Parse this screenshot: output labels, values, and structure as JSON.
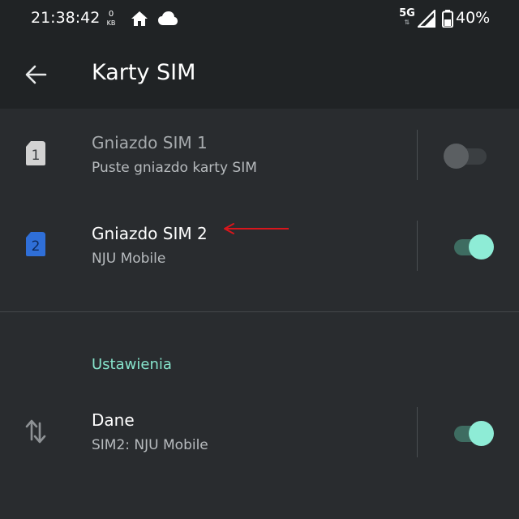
{
  "status_bar": {
    "time": "21:38:42",
    "net_speed_value": "0",
    "net_speed_unit": "KB",
    "network_type": "5G",
    "battery": "40%",
    "icons": [
      "home-icon",
      "cloud-icon",
      "signal-icon",
      "battery-icon"
    ]
  },
  "app_bar": {
    "title": "Karty SIM",
    "back_icon": "arrow-back-icon"
  },
  "sim_slots": [
    {
      "title": "Gniazdo SIM 1",
      "summary": "Puste gniazdo karty SIM",
      "badge": "1",
      "badge_color": "#d2d2d2",
      "enabled": false
    },
    {
      "title": "Gniazdo SIM 2",
      "summary": "NJU Mobile",
      "badge": "2",
      "badge_color": "#2f6fd8",
      "enabled": true
    }
  ],
  "settings": {
    "header": "Ustawienia",
    "data": {
      "title": "Dane",
      "summary": "SIM2: NJU Mobile",
      "icon": "swap-vert-icon",
      "enabled": true
    }
  },
  "colors": {
    "accent": "#86e3cb",
    "switch_on_thumb": "#8eecd6",
    "switch_on_track": "#3e6c61",
    "annotation": "#d8161c"
  }
}
